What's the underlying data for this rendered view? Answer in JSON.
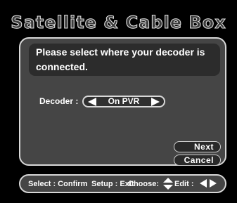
{
  "title": "Satellite & Cable Box",
  "prompt": "Please select  where your decoder  is connected.",
  "decoder": {
    "label": "Decoder :",
    "value": "On PVR"
  },
  "buttons": {
    "next": "Next",
    "cancel": "Cancel"
  },
  "footer": {
    "select": "Select : Confirm",
    "setup": "Setup : Exit",
    "choose": "Choose:",
    "edit": "Edit :"
  },
  "colors": {
    "background": "#000000",
    "panel": "#454545",
    "prompt_box": "#2c2c2c",
    "border": "#d8d8d8",
    "text": "#ffffff"
  },
  "icons": {
    "decoder_prev": "triangle-left-icon",
    "decoder_next": "triangle-right-icon",
    "choose": "up-down-arrows-icon",
    "edit": "left-right-arrows-icon"
  }
}
